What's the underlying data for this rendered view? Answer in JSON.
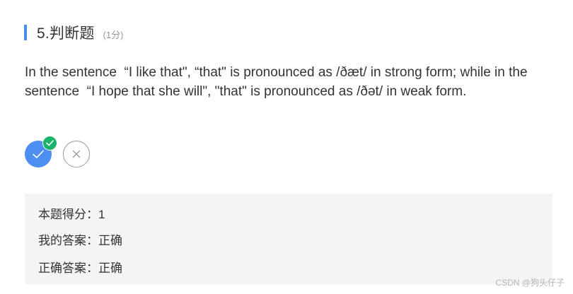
{
  "question": {
    "title": "5.判断题",
    "score": "(1分)",
    "body": "In the sentence  “I like that\", “that\" is pronounced as /ðæt/ in strong form; while in the sentence  “I hope that she will\", \"that\" is pronounced as /ðət/ in weak form."
  },
  "options": [
    {
      "name": "true",
      "icon": "check-icon",
      "selected": true
    },
    {
      "name": "false",
      "icon": "close-icon",
      "selected": false
    }
  ],
  "result": {
    "score_line": "本题得分：1",
    "my_answer_line": "我的答案：正确",
    "correct_answer_line": "正确答案：正确"
  },
  "watermark": "CSDN @狗头仔子",
  "colors": {
    "accent": "#4a90e2",
    "selected_option": "#4d8ff2",
    "badge": "#19b36b",
    "panel_bg": "#f4f4f4"
  }
}
